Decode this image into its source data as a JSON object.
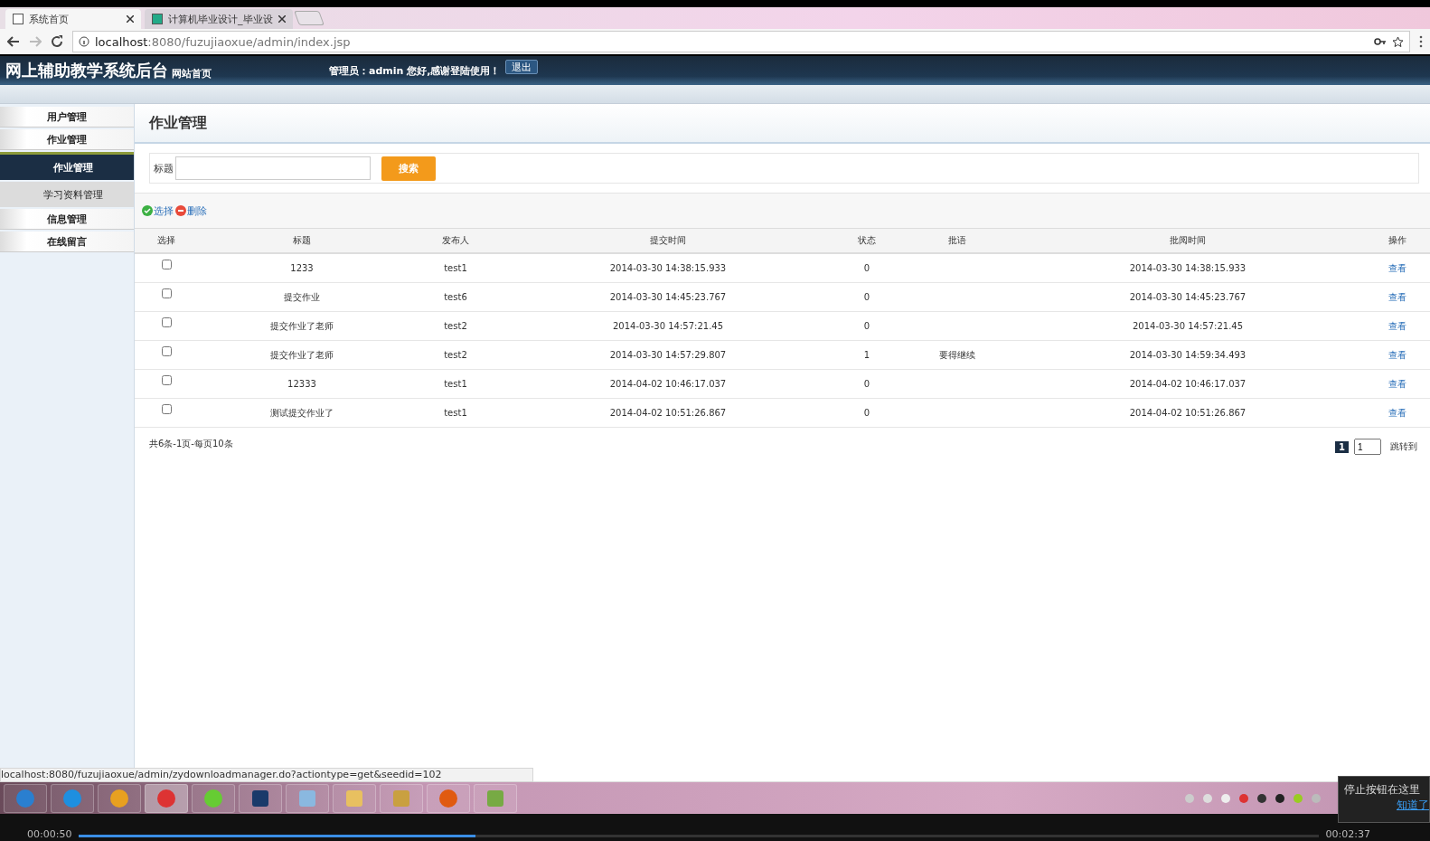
{
  "browser": {
    "tabs": [
      {
        "title": "系统首页",
        "selected": true
      },
      {
        "title": "计算机毕业设计_毕业设",
        "selected": false
      }
    ],
    "url_host": "localhost",
    "url_rest": ":8080/fuzujiaoxue/admin/index.jsp",
    "status_url": "localhost:8080/fuzujiaoxue/admin/zydownloadmanager.do?actiontype=get&seedid=102"
  },
  "header": {
    "title": "网上辅助教学系统后台",
    "home_link": "网站首页",
    "greeting": "管理员：admin 您好,感谢登陆使用！",
    "logout": "退出"
  },
  "sidebar": {
    "items": [
      {
        "label": "用户管理",
        "selected": false
      },
      {
        "label": "作业管理",
        "selected": false,
        "children": [
          {
            "label": "作业管理",
            "selected": true
          },
          {
            "label": "学习资料管理",
            "selected": false
          }
        ]
      },
      {
        "label": "信息管理",
        "selected": false
      },
      {
        "label": "在线留言",
        "selected": false
      }
    ]
  },
  "page_title": "作业管理",
  "search": {
    "label": "标题",
    "button": "搜索"
  },
  "actions": [
    {
      "kind": "select",
      "label": "选择"
    },
    {
      "kind": "delete",
      "label": "删除"
    }
  ],
  "table": {
    "columns": [
      "选择",
      "标题",
      "发布人",
      "提交时间",
      "状态",
      "批语",
      "批阅时间",
      "操作"
    ],
    "rows": [
      {
        "checked": false,
        "title": "1233",
        "publisher": "test1",
        "submitted": "2014-03-30 14:38:15.933",
        "status": "0",
        "reviewed": "2014-03-30 14:38:15.933",
        "action": "查看"
      },
      {
        "checked": false,
        "title": "提交作业",
        "publisher": "test6",
        "submitted": "2014-03-30 14:45:23.767",
        "status": "0",
        "reviewed": "2014-03-30 14:45:23.767",
        "action": "查看"
      },
      {
        "checked": false,
        "title": "提交作业了老师",
        "publisher": "test2",
        "submitted": "2014-03-30 14:57:21.45",
        "status": "0",
        "reviewed": "2014-03-30 14:57:21.45",
        "action": "查看"
      },
      {
        "checked": false,
        "title": "提交作业了老师",
        "publisher": "test2",
        "submitted": "2014-03-30 14:57:29.807",
        "status": "1",
        "comment": "要得继续",
        "reviewed": "2014-03-30 14:59:34.493",
        "action": "查看"
      },
      {
        "checked": false,
        "title": "12333",
        "publisher": "test1",
        "submitted": "2014-04-02 10:46:17.037",
        "status": "0",
        "reviewed": "2014-04-02 10:46:17.037",
        "action": "查看"
      },
      {
        "checked": false,
        "title": "测试提交作业了",
        "publisher": "test1",
        "submitted": "2014-04-02 10:51:26.867",
        "status": "0",
        "reviewed": "2014-04-02 10:51:26.867",
        "action": "查看"
      }
    ]
  },
  "pagination": {
    "summary": "共6条-1页-每页10条",
    "current": "1",
    "page_input": "1",
    "jump": "跳转到"
  },
  "player": {
    "elapsed": "00:00:50",
    "total": "00:02:37",
    "level": 0.32,
    "tip": "停止按钮在这里",
    "tip_link": "知道了"
  }
}
